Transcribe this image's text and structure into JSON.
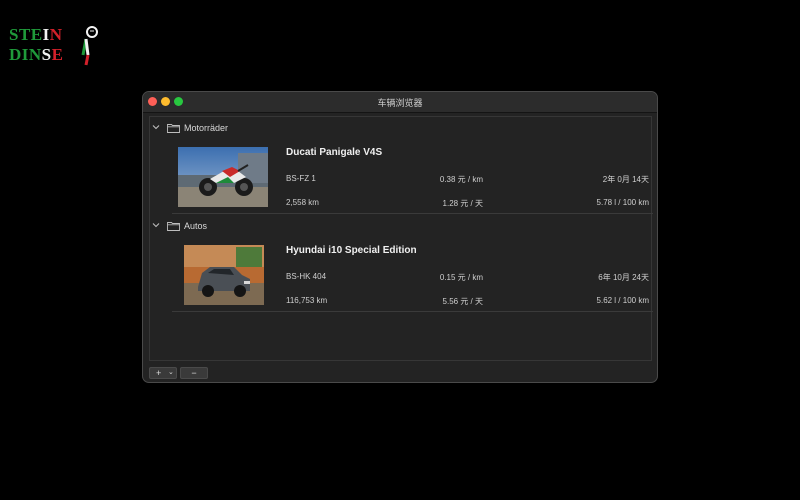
{
  "logo": {
    "line1": [
      "STE",
      "I",
      "N"
    ],
    "line2": [
      "DIN",
      "S",
      "E"
    ]
  },
  "window": {
    "title": "车辆浏览器"
  },
  "groups": [
    {
      "label": "Motorräder",
      "icon": "folder-icon",
      "vehicles": [
        {
          "name": "Ducati Panigale V4S",
          "plate": "BS-FZ 1",
          "cost_per_km": "0.38 元 / km",
          "age": "2年 0月 14天",
          "distance": "2,558 km",
          "cost_per_day": "1.28 元 / 天",
          "consumption": "5.78 l / 100 km"
        }
      ]
    },
    {
      "label": "Autos",
      "icon": "folder-icon",
      "vehicles": [
        {
          "name": "Hyundai i10 Special Edition",
          "plate": "BS-HK 404",
          "cost_per_km": "0.15 元 / km",
          "age": "6年 10月 24天",
          "distance": "116,753 km",
          "cost_per_day": "5.56 元 / 天",
          "consumption": "5.62 l / 100 km"
        }
      ]
    }
  ],
  "toolbar": {
    "add_label": "+",
    "add_menu_icon": "chevron-down-icon",
    "remove_label": "−"
  },
  "colors": {
    "background": "#000000",
    "window": "#232323",
    "green": "#1f9a3a",
    "red": "#d2202a"
  }
}
